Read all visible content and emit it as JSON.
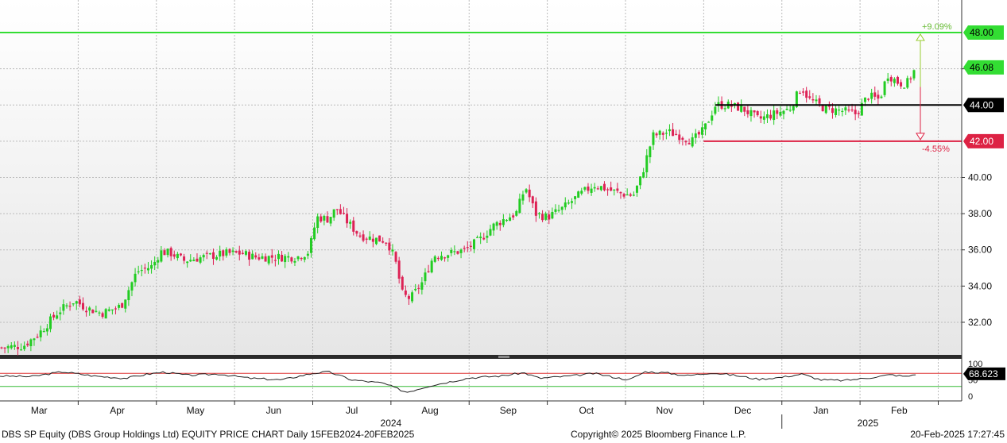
{
  "footer": {
    "left": "DBS SP Equity (DBS Group Holdings Ltd) EQUITY PRICE CHART  Daily 15FEB2024-20FEB2025",
    "middle": "Copyright© 2025 Bloomberg Finance L.P.",
    "right": "20-Feb-2025 17:27:45"
  },
  "colors": {
    "up": "#22cc22",
    "down": "#dd2255",
    "target_up": "#33dd33",
    "target_down": "#dd2244",
    "support": "#000000",
    "rsi": "#222222",
    "rsi_upper": "#dd3333",
    "rsi_lower": "#33bb33",
    "grid": "#bbbbbb",
    "axis_bg": "#ffffff"
  },
  "chart_data": [
    {
      "type": "candlestick",
      "ylim": [
        30.2,
        49.8
      ],
      "y_ticks": [
        "32.00",
        "34.00",
        "36.00",
        "38.00",
        "40.00",
        "42.00",
        "44.00",
        "46.00",
        "48.00"
      ],
      "grid": true,
      "months": [
        {
          "label": "Mar",
          "x": 0.5
        },
        {
          "label": "Apr",
          "x": 1.5
        },
        {
          "label": "May",
          "x": 2.5
        },
        {
          "label": "Jun",
          "x": 3.5
        },
        {
          "label": "Jul",
          "x": 4.5
        },
        {
          "label": "Aug",
          "x": 5.5
        },
        {
          "label": "Sep",
          "x": 6.5
        },
        {
          "label": "Oct",
          "x": 7.5
        },
        {
          "label": "Nov",
          "x": 8.5
        },
        {
          "label": "Dec",
          "x": 9.5
        },
        {
          "label": "Jan",
          "x": 10.5
        },
        {
          "label": "Feb",
          "x": 11.5
        }
      ],
      "year_labels": [
        {
          "label": "2024",
          "x": 5.0
        },
        {
          "label": "2025",
          "x": 11.1
        }
      ],
      "x_range": [
        0,
        12.3
      ],
      "last_price": "46.08",
      "levels": [
        {
          "value": 48.0,
          "label": "48.00",
          "kind": "target_up",
          "pct": "+9.09%"
        },
        {
          "value": 44.0,
          "label": "44.00",
          "kind": "support"
        },
        {
          "value": 42.0,
          "label": "42.00",
          "kind": "target_down",
          "pct": "-4.55%"
        }
      ],
      "waypoints": [
        [
          0.0,
          30.6
        ],
        [
          0.3,
          30.7
        ],
        [
          0.5,
          31.4
        ],
        [
          0.75,
          32.6
        ],
        [
          0.95,
          33.2
        ],
        [
          1.1,
          32.8
        ],
        [
          1.3,
          32.5
        ],
        [
          1.55,
          32.9
        ],
        [
          1.75,
          34.8
        ],
        [
          1.95,
          35.1
        ],
        [
          2.05,
          35.9
        ],
        [
          2.2,
          35.8
        ],
        [
          2.35,
          35.4
        ],
        [
          2.6,
          35.6
        ],
        [
          2.9,
          35.8
        ],
        [
          3.1,
          35.8
        ],
        [
          3.25,
          35.6
        ],
        [
          3.55,
          35.6
        ],
        [
          3.8,
          35.6
        ],
        [
          3.95,
          35.9
        ],
        [
          4.05,
          37.8
        ],
        [
          4.2,
          37.7
        ],
        [
          4.3,
          38.3
        ],
        [
          4.45,
          37.5
        ],
        [
          4.6,
          36.8
        ],
        [
          4.8,
          36.6
        ],
        [
          4.95,
          36.5
        ],
        [
          5.05,
          35.5
        ],
        [
          5.15,
          33.5
        ],
        [
          5.25,
          33.3
        ],
        [
          5.4,
          34.2
        ],
        [
          5.55,
          35.7
        ],
        [
          5.75,
          35.8
        ],
        [
          5.95,
          36.0
        ],
        [
          6.15,
          36.6
        ],
        [
          6.3,
          37.3
        ],
        [
          6.45,
          37.7
        ],
        [
          6.6,
          38.0
        ],
        [
          6.72,
          39.5
        ],
        [
          6.85,
          38.0
        ],
        [
          7.0,
          37.8
        ],
        [
          7.2,
          38.3
        ],
        [
          7.4,
          39.0
        ],
        [
          7.6,
          39.6
        ],
        [
          7.8,
          39.3
        ],
        [
          7.95,
          39.1
        ],
        [
          8.1,
          39.0
        ],
        [
          8.2,
          40.0
        ],
        [
          8.35,
          42.3
        ],
        [
          8.55,
          42.5
        ],
        [
          8.7,
          42.3
        ],
        [
          8.85,
          42.0
        ],
        [
          9.0,
          42.6
        ],
        [
          9.15,
          44.0
        ],
        [
          9.3,
          44.0
        ],
        [
          9.5,
          43.8
        ],
        [
          9.7,
          43.2
        ],
        [
          9.9,
          43.5
        ],
        [
          10.1,
          43.8
        ],
        [
          10.25,
          45.0
        ],
        [
          10.35,
          44.3
        ],
        [
          10.55,
          43.8
        ],
        [
          10.75,
          43.7
        ],
        [
          10.95,
          43.5
        ],
        [
          11.1,
          44.5
        ],
        [
          11.25,
          44.3
        ],
        [
          11.35,
          45.7
        ],
        [
          11.5,
          45.2
        ],
        [
          11.6,
          45.2
        ],
        [
          11.72,
          46.1
        ]
      ],
      "rsi": {
        "ylim": [
          0,
          100
        ],
        "y_ticks": [
          "100",
          "50",
          "0"
        ],
        "last": "68.623",
        "upper": 70,
        "lower": 30,
        "waypoints": [
          [
            0.0,
            62
          ],
          [
            0.4,
            60
          ],
          [
            0.8,
            75
          ],
          [
            1.2,
            62
          ],
          [
            1.6,
            55
          ],
          [
            1.9,
            68
          ],
          [
            2.1,
            74
          ],
          [
            2.4,
            64
          ],
          [
            2.8,
            68
          ],
          [
            3.2,
            55
          ],
          [
            3.6,
            50
          ],
          [
            4.0,
            70
          ],
          [
            4.2,
            75
          ],
          [
            4.5,
            50
          ],
          [
            4.9,
            40
          ],
          [
            5.2,
            12
          ],
          [
            5.5,
            32
          ],
          [
            6.0,
            56
          ],
          [
            6.4,
            62
          ],
          [
            6.7,
            72
          ],
          [
            6.9,
            55
          ],
          [
            7.3,
            62
          ],
          [
            7.6,
            70
          ],
          [
            7.9,
            56
          ],
          [
            8.05,
            50
          ],
          [
            8.25,
            75
          ],
          [
            8.5,
            72
          ],
          [
            8.8,
            63
          ],
          [
            9.1,
            72
          ],
          [
            9.4,
            64
          ],
          [
            9.7,
            52
          ],
          [
            10.0,
            58
          ],
          [
            10.25,
            68
          ],
          [
            10.5,
            50
          ],
          [
            10.8,
            48
          ],
          [
            11.1,
            56
          ],
          [
            11.4,
            66
          ],
          [
            11.6,
            60
          ],
          [
            11.72,
            68.6
          ]
        ]
      }
    }
  ]
}
